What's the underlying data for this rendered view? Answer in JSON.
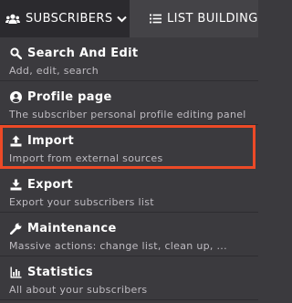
{
  "navbar": {
    "active_tab": {
      "label": "SUBSCRIBERS",
      "icon": "users-icon",
      "dropdown_icon": "chevron-down-icon"
    },
    "other_tab": {
      "label": "LIST BUILDING",
      "icon": "list-icon"
    }
  },
  "menu": {
    "items": [
      {
        "title": "Search And Edit",
        "desc": "Add, edit, search",
        "icon": "search-icon"
      },
      {
        "title": "Profile page",
        "desc": "The subscriber personal profile editing panel",
        "icon": "user-circle-icon"
      },
      {
        "title": "Import",
        "desc": "Import from external sources",
        "icon": "upload-icon"
      },
      {
        "title": "Export",
        "desc": "Export your subscribers list",
        "icon": "download-icon"
      },
      {
        "title": "Maintenance",
        "desc": "Massive actions: change list, clean up, ...",
        "icon": "wrench-icon"
      },
      {
        "title": "Statistics",
        "desc": "All about your subscribers",
        "icon": "bar-chart-icon"
      }
    ]
  },
  "colors": {
    "background": "#3b3a3e",
    "active_tab": "#2b2a2e",
    "highlight": "#ec4a27"
  }
}
